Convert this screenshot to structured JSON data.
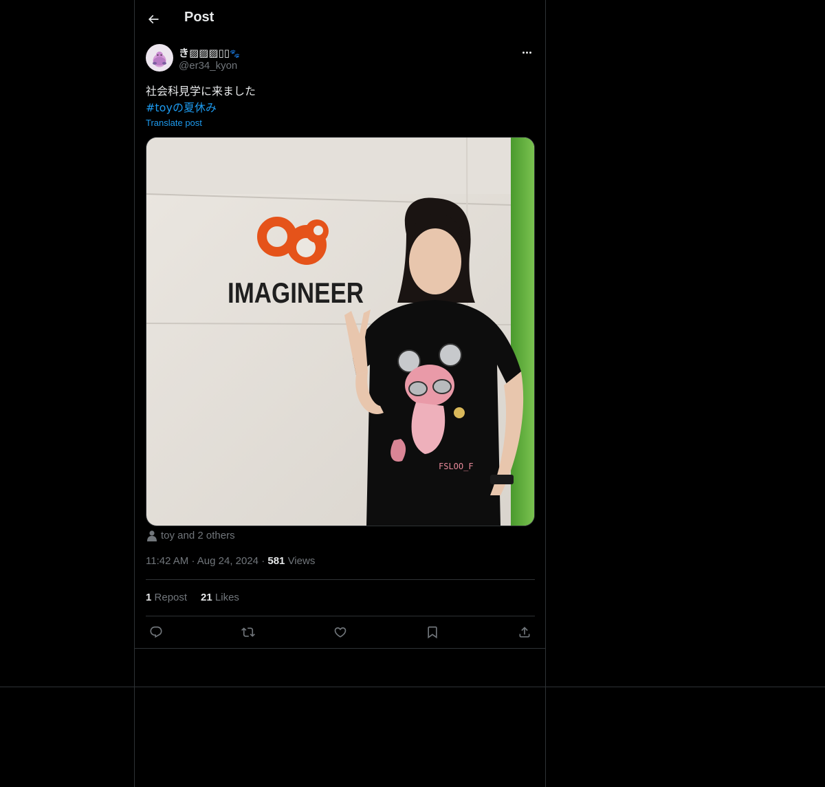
{
  "header": {
    "title": "Post",
    "back_icon": "arrow-left-icon"
  },
  "post": {
    "author": {
      "display_name": "き▨▨▨▯▯",
      "emoji": "🐾",
      "handle": "@er34_kyon"
    },
    "text_line": "社会科見学に来ました",
    "hashtag": "#toyの夏休み",
    "translate_label": "Translate post",
    "image_sign_text": "IMAGINEER",
    "shirt_text": "FSLOO_F",
    "tagged_label": "toy and 2 others",
    "time": "11:42 AM",
    "date": "Aug 24, 2024",
    "views_count": "581",
    "views_label": "Views",
    "reposts_count": "1",
    "reposts_label": "Repost",
    "likes_count": "21",
    "likes_label": "Likes"
  },
  "colors": {
    "background": "#000000",
    "text": "#e7e9ea",
    "secondary": "#71767b",
    "accent": "#1d9bf0",
    "border": "#2f3336",
    "logo_orange": "#e5531a"
  }
}
